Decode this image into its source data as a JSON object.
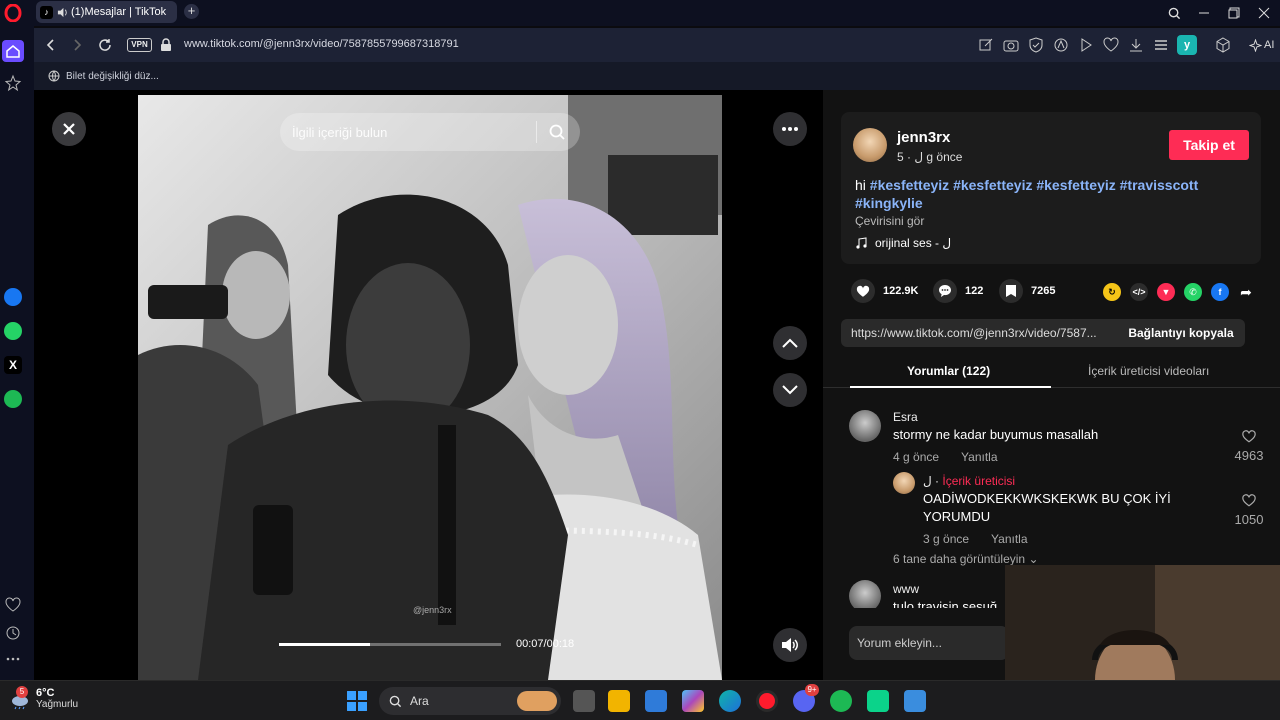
{
  "browser": {
    "tab_title": "(1)Mesajlar | TikTok",
    "url": "www.tiktok.com/@jenn3rx/video/7587855799687318791",
    "vpn_label": "VPN",
    "ai_label": "AI",
    "ext_y_label": "y",
    "bookmark_label": "Bilet değişikliği düz..."
  },
  "video": {
    "search_placeholder": "İlgili içeriği bulun",
    "time": "00:07/00:18",
    "progress": 0.41,
    "watermark": "@jenn3rx"
  },
  "post": {
    "username": "jenn3rx",
    "meta": "ل · 5 g önce",
    "follow_label": "Takip et",
    "caption_prefix": "hi",
    "hashtags": [
      "#kesfetteyiz",
      "#kesfetteyiz",
      "#kesfetteyiz",
      "#travisscott",
      "#kingkylie"
    ],
    "translate_label": "Çevirisini gör",
    "sound": "orijinal ses - ل",
    "likes": "122.9K",
    "comments": "122",
    "saves": "7265",
    "link": "https://www.tiktok.com/@jenn3rx/video/7587...",
    "copy_label": "Bağlantıyı kopyala"
  },
  "tabs": {
    "comments_tab": "Yorumlar (122)",
    "creator_videos_tab": "İçerik üreticisi videoları"
  },
  "comments": [
    {
      "name": "Esra",
      "text": "stormy ne kadar buyumus masallah",
      "time": "4 g önce",
      "reply_label": "Yanıtla",
      "likes": "4963"
    },
    {
      "name": "ل",
      "badge": "İçerik üreticisi",
      "text_line1": "OADİWODKEKKWKSKEKWK BU ÇOK İYİ",
      "text_line2": "YORUMDU",
      "time": "3 g önce",
      "reply_label": "Yanıtla",
      "likes": "1050"
    },
    {
      "name": "www",
      "text": "tulo travisin sesuğ"
    }
  ],
  "more_replies": "6 tane daha görüntüleyin",
  "add_comment_placeholder": "Yorum ekleyin...",
  "taskbar": {
    "temp": "6°C",
    "weather": "Yağmurlu",
    "search_label": "Ara",
    "notif_badge": "5",
    "discord_badge": "9+"
  },
  "colors": {
    "accent_red": "#fe2c55",
    "hashtag_blue": "#8ab4f8",
    "panel_bg": "#121212"
  }
}
